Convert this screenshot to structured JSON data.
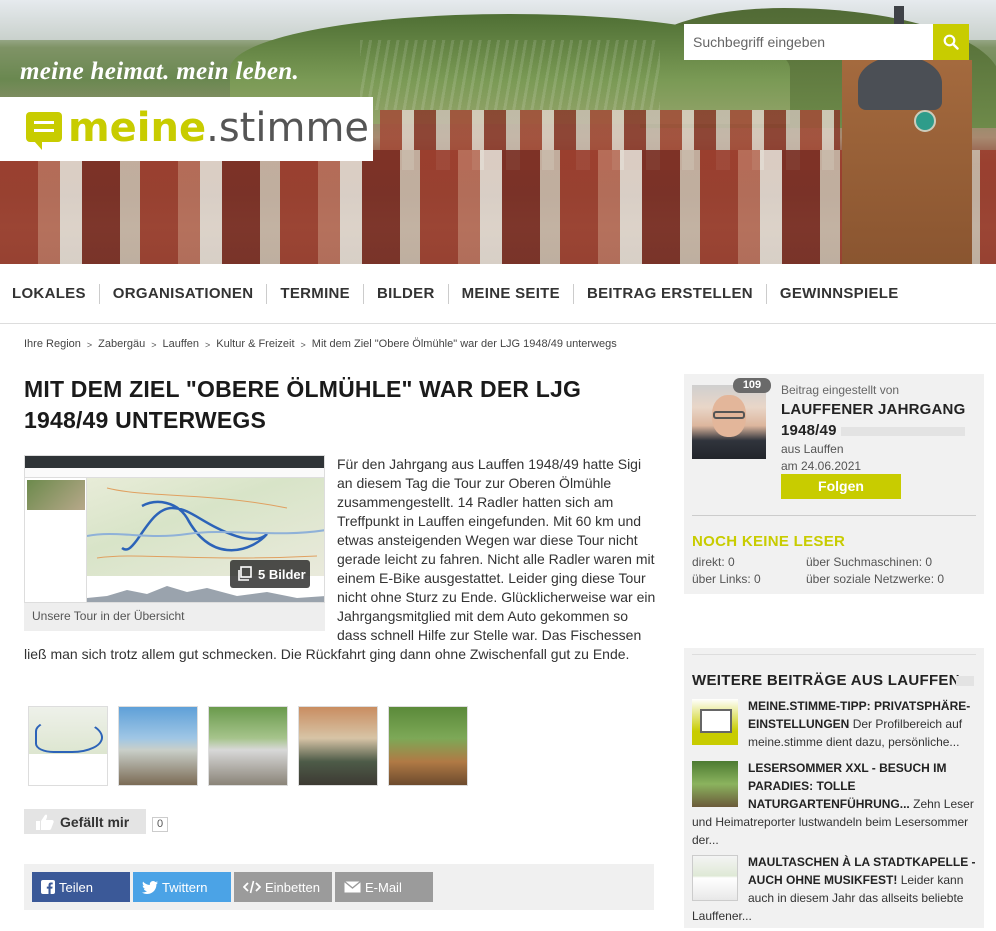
{
  "header": {
    "tagline": "meine heimat. mein leben.",
    "logo_part1": "meine",
    "logo_part2": ".stimme",
    "search_placeholder": "Suchbegriff eingeben",
    "accent_color": "#c8cc00"
  },
  "nav": {
    "items": [
      "LOKALES",
      "ORGANISATIONEN",
      "TERMINE",
      "BILDER",
      "MEINE SEITE",
      "BEITRAG ERSTELLEN",
      "GEWINNSPIELE"
    ]
  },
  "breadcrumb": {
    "items": [
      "Ihre Region",
      "Zabergäu",
      "Lauffen",
      "Kultur & Freizeit",
      "Mit dem Ziel \"Obere Ölmühle\" war der LJG 1948/49 unterwegs"
    ]
  },
  "article": {
    "title": "MIT DEM ZIEL \"OBERE ÖLMÜHLE\" WAR DER LJG 1948/49 UNTERWEGS",
    "image_caption": "Unsere Tour in der Übersicht",
    "images_badge": "5 Bilder",
    "body": "Für den Jahrgang aus Lauffen 1948/49 hatte Sigi an diesem Tag die Tour zur Oberen Ölmühle zusammengestellt. 14 Radler hatten sich am Treffpunkt in Lauffen eingefunden. Mit 60 km und etwas ansteigenden Wegen war diese Tour nicht gerade leicht zu fahren. Nicht alle Radler waren mit einem E-Bike ausgestattet. Leider ging diese Tour nicht ohne Sturz zu Ende. Glücklicherweise war ein Jahrgangsmitglied mit dem Auto gekommen so dass schnell Hilfe zur Stelle war. Das Fischessen ließ man sich trotz allem gut schmecken. Die Rückfahrt ging dann ohne Zwischenfall gut zu Ende.",
    "like_label": "Gefällt mir",
    "like_count": "0"
  },
  "share": {
    "facebook": "Teilen",
    "twitter": "Twittern",
    "embed": "Einbetten",
    "email": "E-Mail"
  },
  "author": {
    "badge": "109",
    "posted_by": "Beitrag eingestellt von",
    "name_line1": "LAUFFENER JAHRGANG",
    "name_line2": "1948/49",
    "location": "aus Lauffen",
    "date": "am 24.06.2021",
    "follow": "Folgen"
  },
  "readers": {
    "title": "NOCH KEINE LESER",
    "direct": "direkt: 0",
    "search": "über Suchmaschinen: 0",
    "links": "über Links: 0",
    "social": "über soziale Netzwerke: 0"
  },
  "more": {
    "title": "WEITERE BEITRÄGE AUS LAUFFEN",
    "items": [
      {
        "headline": "MEINE.STIMME-TIPP: PRIVATSPHÄRE-EINSTELLUNGEN",
        "teaser": "Der Profilbereich auf meine.stimme dient dazu, persönliche..."
      },
      {
        "headline": "LESERSOMMER XXL - BESUCH IM PARADIES: TOLLE NATURGARTENFÜHRUNG...",
        "teaser": "Zehn Leser und Heimatreporter lustwandeln beim Lesersommer der..."
      },
      {
        "headline": "MAULTASCHEN À LA STADTKAPELLE - AUCH OHNE MUSIKFEST!",
        "teaser": "Leider kann auch in diesem Jahr das allseits beliebte Lauffener..."
      }
    ]
  }
}
